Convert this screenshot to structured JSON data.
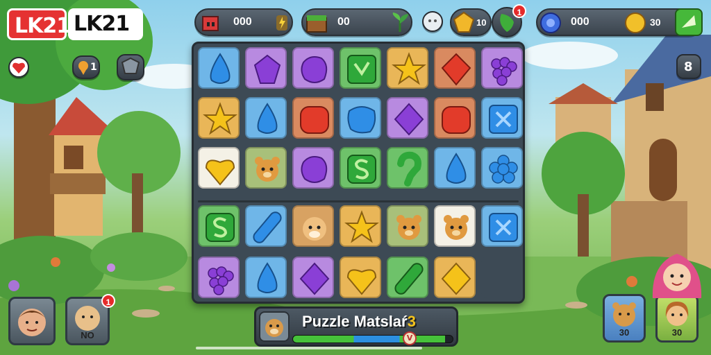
{
  "logos": {
    "red": "LK21",
    "white": "LK21"
  },
  "hud": {
    "lives_value": "000",
    "chest_value": "00",
    "gem_value": "10",
    "gem_badge": "1",
    "coin_value": "000",
    "coin_value_2": "30"
  },
  "side": {
    "level_value": "1",
    "right_level": "8"
  },
  "board": {
    "rows": [
      [
        "blue-drop",
        "purple-gem",
        "purple-blob",
        "green-leaf",
        "yellow-star",
        "red-diamond",
        "purple-grapes"
      ],
      [
        "yellow-star",
        "blue-drop",
        "red-blob",
        "blue-blob",
        "purple-diamond",
        "red-blob",
        "blue-x"
      ],
      [
        "yellow-heart-selected",
        "bear",
        "purple-blob",
        "green-s",
        "green-hook",
        "blue-drop",
        "blue-flower"
      ],
      [
        "green-s",
        "blue-bar",
        "hamster",
        "yellow-star",
        "bear",
        "bear-selected",
        "blue-x"
      ],
      [
        "purple-grapes",
        "blue-drop",
        "purple-diamond",
        "yellow-heart",
        "green-bar",
        "yellow-diamond",
        "empty"
      ]
    ]
  },
  "bottom": {
    "title": "Puzzle Matslaŕ",
    "title_number": "3",
    "progress_marker": "V",
    "progress": 0.95
  },
  "players": {
    "left_1": "",
    "left_2": "NO",
    "left_2_badge": "1",
    "right_1": "30",
    "right_2": "30"
  },
  "colors": {
    "board": "#3d4a55",
    "accent_red": "#e53232",
    "gold": "#f3c21c"
  }
}
